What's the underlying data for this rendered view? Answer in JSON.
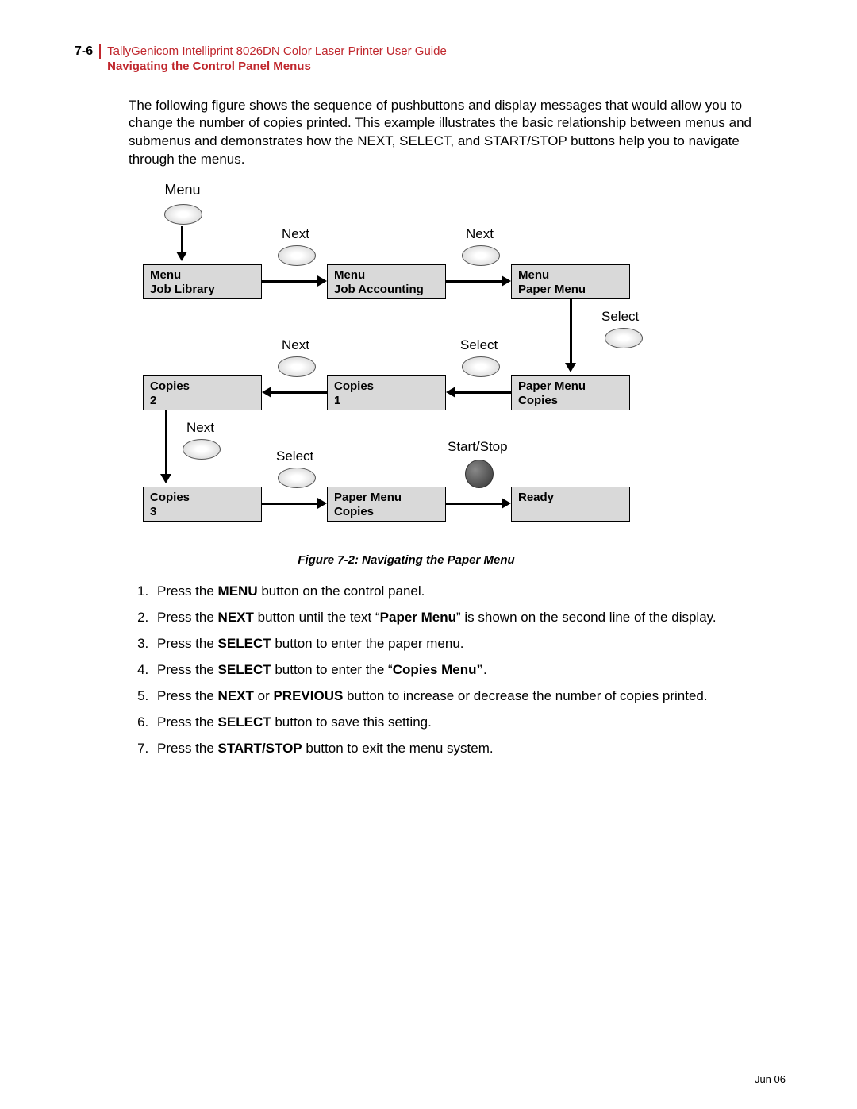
{
  "page_number": "7-6",
  "header_title": "TallyGenicom Intelliprint 8026DN Color Laser Printer User Guide",
  "header_subtitle": "Navigating the Control Panel Menus",
  "intro_text": "The following figure shows the sequence of pushbuttons and display messages that would allow you to change the number of copies printed. This example illustrates the basic relationship between menus and submenus and demonstrates how the NEXT, SELECT, and START/STOP buttons help you to navigate through the menus.",
  "diagram": {
    "top_label": "Menu",
    "button_labels": {
      "next1": "Next",
      "next2": "Next",
      "select1": "Select",
      "next3": "Next",
      "select2": "Select",
      "next4": "Next",
      "select3": "Select",
      "startstop": "Start/Stop"
    },
    "boxes": {
      "r1c1_l1": "Menu",
      "r1c1_l2": "Job Library",
      "r1c2_l1": "Menu",
      "r1c2_l2": "Job Accounting",
      "r1c3_l1": "Menu",
      "r1c3_l2": "Paper Menu",
      "r2c1_l1": "Copies",
      "r2c1_l2": "2",
      "r2c2_l1": "Copies",
      "r2c2_l2": "1",
      "r2c3_l1": "Paper Menu",
      "r2c3_l2": "Copies",
      "r3c1_l1": "Copies",
      "r3c1_l2": "3",
      "r3c2_l1": "Paper Menu",
      "r3c2_l2": "Copies",
      "r3c3_l1": "Ready",
      "r3c3_l2": ""
    }
  },
  "caption": "Figure 7-2:  Navigating the Paper Menu",
  "steps": [
    {
      "pre": "Press the ",
      "b1": "MENU",
      "mid1": " button on the control panel.",
      "b2": "",
      "mid2": "",
      "b3": "",
      "post": ""
    },
    {
      "pre": "Press the ",
      "b1": "NEXT",
      "mid1": " button until the text “",
      "b2": "Paper Menu",
      "mid2": "” is shown on the second line of the display.",
      "b3": "",
      "post": ""
    },
    {
      "pre": "Press the ",
      "b1": "SELECT",
      "mid1": " button to enter the paper menu.",
      "b2": "",
      "mid2": "",
      "b3": "",
      "post": ""
    },
    {
      "pre": "Press the ",
      "b1": "SELECT",
      "mid1": " button to enter the “",
      "b2": "Copies Menu”",
      "mid2": ".",
      "b3": "",
      "post": ""
    },
    {
      "pre": "Press the ",
      "b1": "NEXT",
      "mid1": " or ",
      "b2": "PREVIOUS",
      "mid2": " button to increase or decrease the number of copies printed.",
      "b3": "",
      "post": ""
    },
    {
      "pre": "Press the ",
      "b1": "SELECT",
      "mid1": " button to save this setting.",
      "b2": "",
      "mid2": "",
      "b3": "",
      "post": ""
    },
    {
      "pre": "Press the ",
      "b1": "START/STOP",
      "mid1": " button to exit the menu system.",
      "b2": "",
      "mid2": "",
      "b3": "",
      "post": ""
    }
  ],
  "footer_date": "Jun 06"
}
